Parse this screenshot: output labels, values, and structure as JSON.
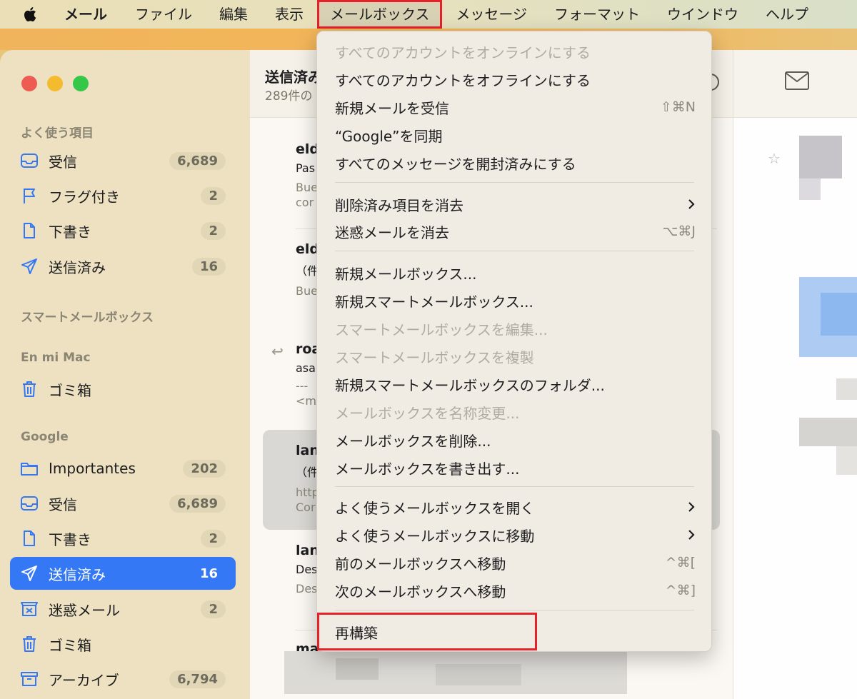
{
  "menubar": {
    "app": "メール",
    "items": [
      "ファイル",
      "編集",
      "表示",
      "メールボックス",
      "メッセージ",
      "フォーマット",
      "ウインドウ",
      "ヘルプ"
    ]
  },
  "sidebar": {
    "sections": {
      "favorites": "よく使う項目",
      "smart": "スマートメールボックス",
      "on_mac": "En mi Mac",
      "google": "Google"
    },
    "favorites": [
      {
        "label": "受信",
        "count": "6,689",
        "icon": "inbox-icon"
      },
      {
        "label": "フラグ付き",
        "count": "2",
        "icon": "flag-icon"
      },
      {
        "label": "下書き",
        "count": "2",
        "icon": "draft-icon"
      },
      {
        "label": "送信済み",
        "count": "16",
        "icon": "sent-icon"
      }
    ],
    "on_mac": [
      {
        "label": "ゴミ箱",
        "icon": "trash-icon"
      }
    ],
    "google": [
      {
        "label": "Importantes",
        "count": "202",
        "icon": "folder-icon"
      },
      {
        "label": "受信",
        "count": "6,689",
        "icon": "inbox-icon"
      },
      {
        "label": "下書き",
        "count": "2",
        "icon": "draft-icon"
      },
      {
        "label": "送信済み",
        "count": "16",
        "icon": "sent-icon",
        "selected": true
      },
      {
        "label": "迷惑メール",
        "count": "2",
        "icon": "junk-icon"
      },
      {
        "label": "ゴミ箱",
        "icon": "trash-icon"
      },
      {
        "label": "アーカイブ",
        "count": "6,794",
        "icon": "archive-icon"
      }
    ]
  },
  "list": {
    "title": "送信済み",
    "subtitle": "289件の",
    "messages": [
      {
        "from": "eld",
        "l2": "Pas",
        "l3": "Bue",
        "l4": "cor"
      },
      {
        "from": "eld",
        "l2": "（件",
        "l3": "Bue",
        "l4": ""
      },
      {
        "from": "roa",
        "l2": "asa",
        "l3": "---",
        "l4": "<m"
      },
      {
        "from": "lan",
        "l2": "（件",
        "l3": "http",
        "l4": "Cor"
      },
      {
        "from": "lan",
        "l2": "Des",
        "l3": "Des",
        "l4": ""
      },
      {
        "from": "ma",
        "l2": "",
        "l3": "",
        "l4": ""
      }
    ]
  },
  "menu": {
    "groups": [
      [
        {
          "label": "すべてのアカウントをオンラインにする",
          "disabled": true
        },
        {
          "label": "すべてのアカウントをオフラインにする"
        },
        {
          "label": "新規メールを受信",
          "shortcut": "⇧⌘N"
        },
        {
          "label": "“Google”を同期"
        },
        {
          "label": "すべてのメッセージを開封済みにする"
        }
      ],
      [
        {
          "label": "削除済み項目を消去",
          "submenu": true
        },
        {
          "label": "迷惑メールを消去",
          "shortcut": "⌥⌘J"
        }
      ],
      [
        {
          "label": "新規メールボックス..."
        },
        {
          "label": "新規スマートメールボックス..."
        },
        {
          "label": "スマートメールボックスを編集...",
          "disabled": true
        },
        {
          "label": "スマートメールボックスを複製",
          "disabled": true
        },
        {
          "label": "新規スマートメールボックスのフォルダ..."
        },
        {
          "label": "メールボックスを名称変更...",
          "disabled": true
        },
        {
          "label": "メールボックスを削除..."
        },
        {
          "label": "メールボックスを書き出す..."
        }
      ],
      [
        {
          "label": "よく使うメールボックスを開く",
          "submenu": true
        },
        {
          "label": "よく使うメールボックスに移動",
          "submenu": true
        },
        {
          "label": "前のメールボックスへ移動",
          "shortcut": "^⌘["
        },
        {
          "label": "次のメールボックスへ移動",
          "shortcut": "^⌘]"
        }
      ],
      [
        {
          "label": "再構築"
        }
      ]
    ]
  }
}
